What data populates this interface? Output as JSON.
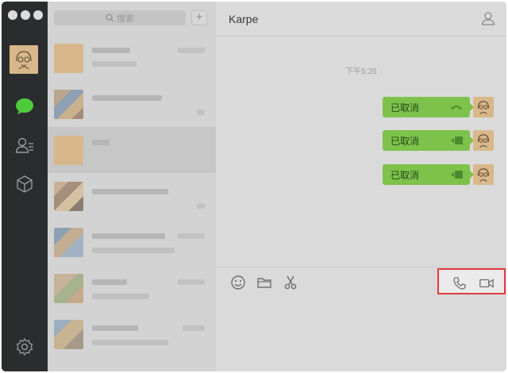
{
  "window": {
    "controls": [
      "close-dot",
      "minimize-dot",
      "zoom-dot"
    ]
  },
  "sidebar": {
    "icons": [
      "avatar",
      "chat-bubble-icon",
      "contacts-icon",
      "cube-icon",
      "gear-icon"
    ],
    "accent_color": "#4ecb3c"
  },
  "search": {
    "placeholder": "搜索",
    "add_label": "+"
  },
  "chat": {
    "title": "Karpe",
    "timestamp": "下午5:26",
    "messages": [
      {
        "text": "已取消",
        "icon": "phone-icon"
      },
      {
        "text": "已取消",
        "icon": "video-icon"
      },
      {
        "text": "已取消",
        "icon": "video-icon"
      }
    ],
    "bubble_color": "#7dc24b",
    "toolbar": [
      "emoji-icon",
      "folder-icon",
      "scissors-icon"
    ],
    "call_buttons": [
      "phone-call-icon",
      "video-call-icon"
    ],
    "highlight_color": "#e03a3a"
  }
}
